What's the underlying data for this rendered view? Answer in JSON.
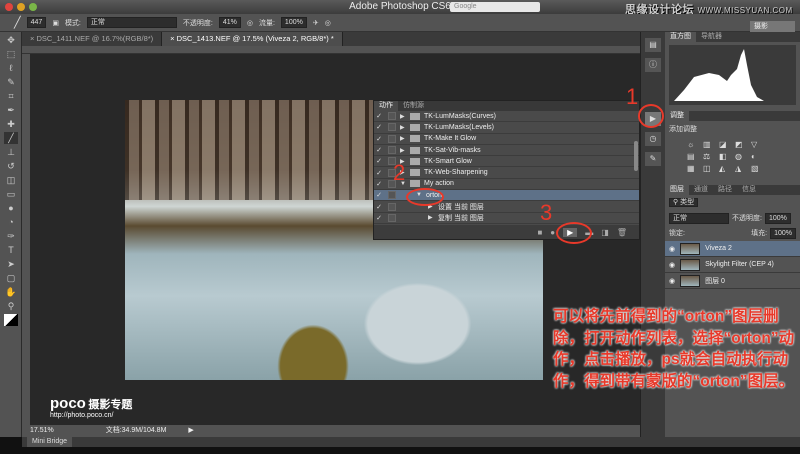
{
  "app": {
    "title": "Adobe Photoshop CS6",
    "search_placeholder": "Google",
    "watermark_cn": "思缘设计论坛",
    "watermark_url": "WWW.MISSYUAN.COM",
    "workspace": "摄影"
  },
  "options": {
    "brush_size": "447",
    "mode_label": "模式:",
    "mode_value": "正常",
    "opacity_label": "不透明度:",
    "opacity_value": "41%",
    "flow_label": "流量:",
    "flow_value": "100%"
  },
  "doc_tabs": [
    {
      "label": "DSC_1411.NEF @ 16.7%(RGB/8*)"
    },
    {
      "label": "DSC_1413.NEF @ 17.5% (Viveza 2, RGB/8*) *"
    }
  ],
  "actions_panel": {
    "tabs": [
      "动作",
      "仿制源"
    ],
    "rows": [
      {
        "label": "TK-LumMasks(Curves)",
        "type": "set"
      },
      {
        "label": "TK-LumMasks(Levels)",
        "type": "set"
      },
      {
        "label": "TK-Make It Glow",
        "type": "set"
      },
      {
        "label": "TK-Sat-Vib-masks",
        "type": "set"
      },
      {
        "label": "TK-Smart Glow",
        "type": "set"
      },
      {
        "label": "TK-Web-Sharpening",
        "type": "set"
      },
      {
        "label": "My action",
        "type": "set-open"
      },
      {
        "label": "orton",
        "type": "action",
        "selected": true
      },
      {
        "label": "设置 当前 图层",
        "type": "step"
      },
      {
        "label": "复制 当前 图层",
        "type": "step"
      }
    ]
  },
  "right": {
    "histogram_tabs": [
      "直方图",
      "导航器"
    ],
    "adjust_tab": "调整",
    "adjust_title": "添加调整",
    "adjust_icons": [
      "☼",
      "▥",
      "◪",
      "◩",
      "▽",
      "▤",
      "⚖",
      "◧",
      "◍",
      "◐",
      "▦",
      "◫",
      "◭",
      "◮",
      "▧"
    ],
    "layers_tabs": [
      "图层",
      "通道",
      "路径",
      "信息"
    ],
    "filter": "类型",
    "blend": "正常",
    "opacity_label": "不透明度:",
    "opacity": "100%",
    "lock_label": "锁定:",
    "fill_label": "填充:",
    "fill": "100%",
    "layers": [
      {
        "name": "Viveza 2",
        "selected": true
      },
      {
        "name": "Skylight Filter (CEP 4)"
      },
      {
        "name": "图层 0"
      }
    ]
  },
  "status": {
    "zoom": "17.51%",
    "doc": "文档:34.9M/104.8M"
  },
  "mini_bridge": "Mini Bridge",
  "logo": {
    "brand": "poco",
    "title": "摄影专题",
    "url": "http://photo.poco.cn/"
  },
  "annotations": {
    "n1": "1",
    "n2": "2",
    "n3": "3",
    "note": "可以将先前得到的“orton”图层删除，打开动作列表，选择“orton”动作，点击播放，ps就会自动执行动作，得到带有蒙版的“orton”图层。",
    "color": "#e8392a"
  }
}
